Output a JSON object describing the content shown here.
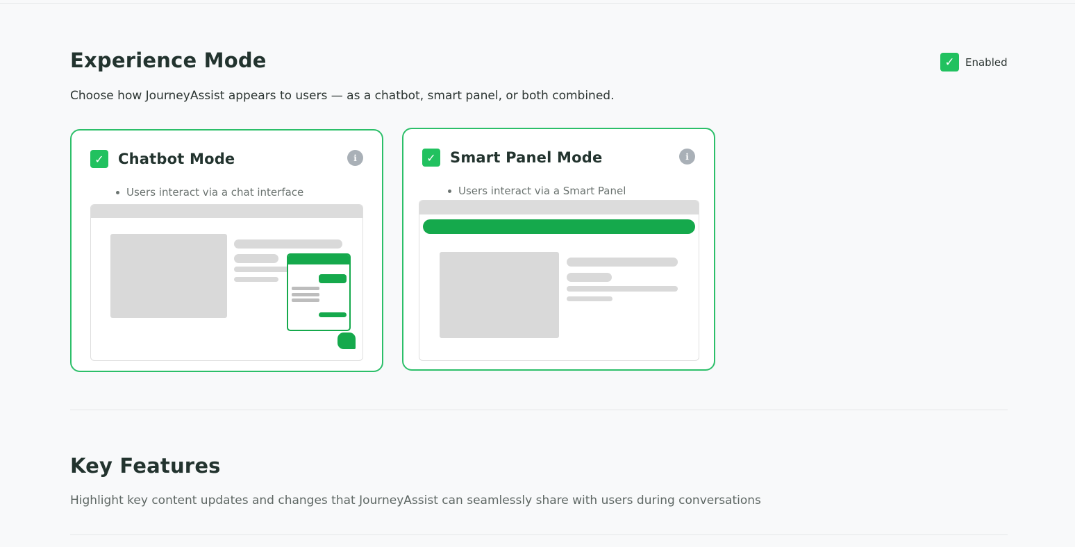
{
  "experience_mode": {
    "title": "Experience Mode",
    "description": "Choose how JourneyAssist appears to users — as a chatbot, smart panel, or both combined.",
    "toggle": {
      "label": "Enabled",
      "checked": true,
      "check_glyph": "✓"
    },
    "cards": [
      {
        "title": "Chatbot Mode",
        "checked": true,
        "check_glyph": "✓",
        "info_glyph": "i",
        "bullet": "Users interact via a chat interface"
      },
      {
        "title": "Smart Panel Mode",
        "checked": true,
        "check_glyph": "✓",
        "info_glyph": "i",
        "bullet": "Users interact via a Smart Panel"
      }
    ]
  },
  "key_features": {
    "title": "Key Features",
    "description": "Highlight key content updates and changes that JourneyAssist can seamlessly share with users during conversations"
  },
  "colors": {
    "accent_green": "#21c15f",
    "card_border": "#2cbf69",
    "preview_green": "#15a94c",
    "info_icon": "#a9b0b7",
    "page_bg": "#f8f9fa"
  }
}
